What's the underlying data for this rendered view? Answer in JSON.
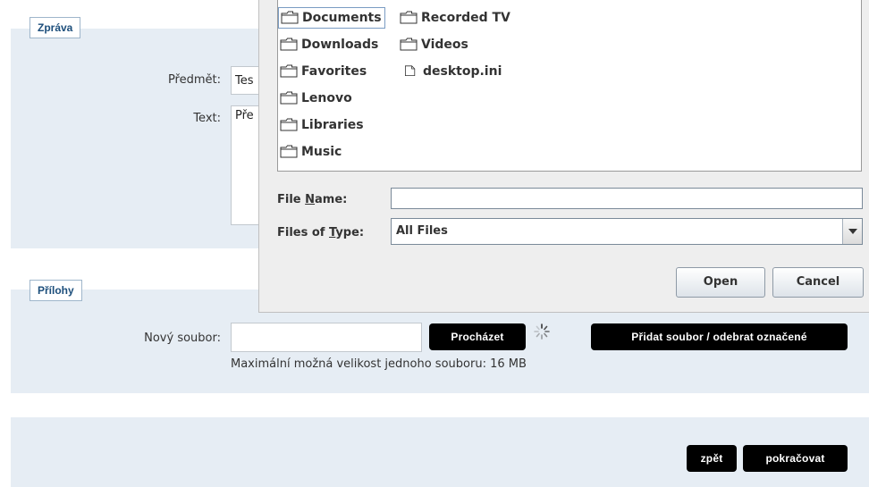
{
  "message_section": {
    "tab_label": "Zpráva",
    "subject_label": "Předmět:",
    "subject_value": "Tes",
    "text_label": "Text:",
    "text_value": "Pře"
  },
  "attachments_section": {
    "tab_label": "Přílohy",
    "new_file_label": "Nový soubor:",
    "new_file_value": "",
    "browse_button": "Procházet",
    "add_remove_button": "Přidat soubor / odebrat označené",
    "max_size_note": "Maximální možná velikost jednoho souboru: 16 MB"
  },
  "footer": {
    "back_button": "zpět",
    "continue_button": "pokračovat"
  },
  "file_dialog": {
    "items_col1": [
      {
        "name": "Documents",
        "icon": "folder-icon",
        "selected": true
      },
      {
        "name": "Downloads",
        "icon": "folder-icon"
      },
      {
        "name": "Favorites",
        "icon": "folder-icon"
      },
      {
        "name": "Lenovo",
        "icon": "folder-icon"
      },
      {
        "name": "Libraries",
        "icon": "folder-icon"
      },
      {
        "name": "Music",
        "icon": "folder-icon"
      }
    ],
    "items_col2": [
      {
        "name": "Recorded TV",
        "icon": "folder-icon"
      },
      {
        "name": "Videos",
        "icon": "folder-icon"
      },
      {
        "name": "desktop.ini",
        "icon": "file-icon"
      }
    ],
    "file_name_label_pre": "File ",
    "file_name_label_mnemonic": "N",
    "file_name_label_post": "ame:",
    "file_name_value": "",
    "files_of_type_label_pre": "Files of ",
    "files_of_type_label_mnemonic": "T",
    "files_of_type_label_post": "ype:",
    "files_of_type_value": "All Files",
    "open_button": "Open",
    "cancel_button": "Cancel"
  }
}
